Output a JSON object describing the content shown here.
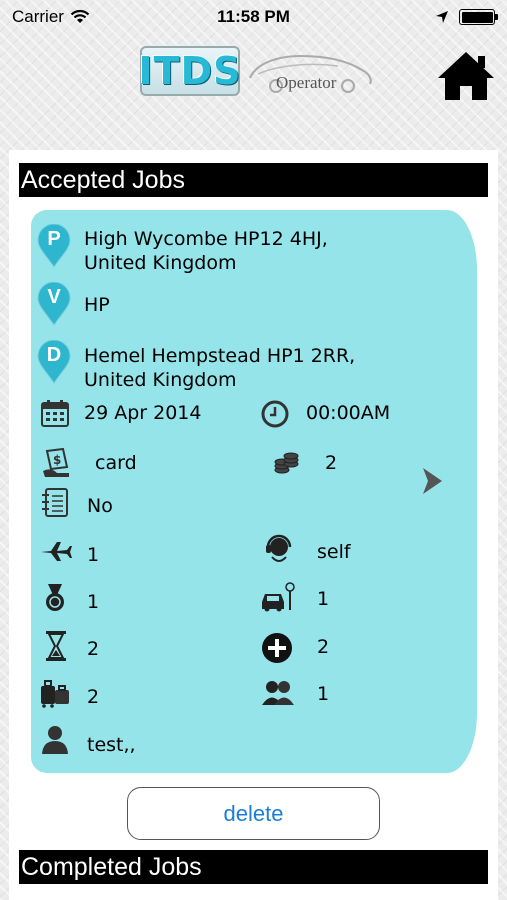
{
  "status_bar": {
    "carrier": "Carrier",
    "time": "11:58 PM"
  },
  "header": {
    "logo_text": "ITDS",
    "logo_subtitle": "Operator"
  },
  "sections": {
    "accepted": "Accepted Jobs",
    "completed": "Completed Jobs"
  },
  "job": {
    "pickup": {
      "badge": "P",
      "line1": "High Wycombe HP12 4HJ,",
      "line2": "United Kingdom"
    },
    "via": {
      "badge": "V",
      "line1": "HP"
    },
    "dropoff": {
      "badge": "D",
      "line1": "Hemel Hempstead HP1 2RR,",
      "line2": "United Kingdom"
    },
    "date": "29 Apr 2014",
    "time": "00:00AM",
    "payment": "card",
    "fare": "2",
    "notes": "No",
    "flights": "1",
    "booked_by": "self",
    "medal": "1",
    "vehicle": "1",
    "wait": "2",
    "extras": "2",
    "luggage": "2",
    "passengers": "1",
    "customer": "test,,"
  },
  "actions": {
    "delete": "delete"
  },
  "colors": {
    "card": "#94e4ea",
    "pin": "#2fb6cf",
    "link": "#1b7fd6"
  }
}
